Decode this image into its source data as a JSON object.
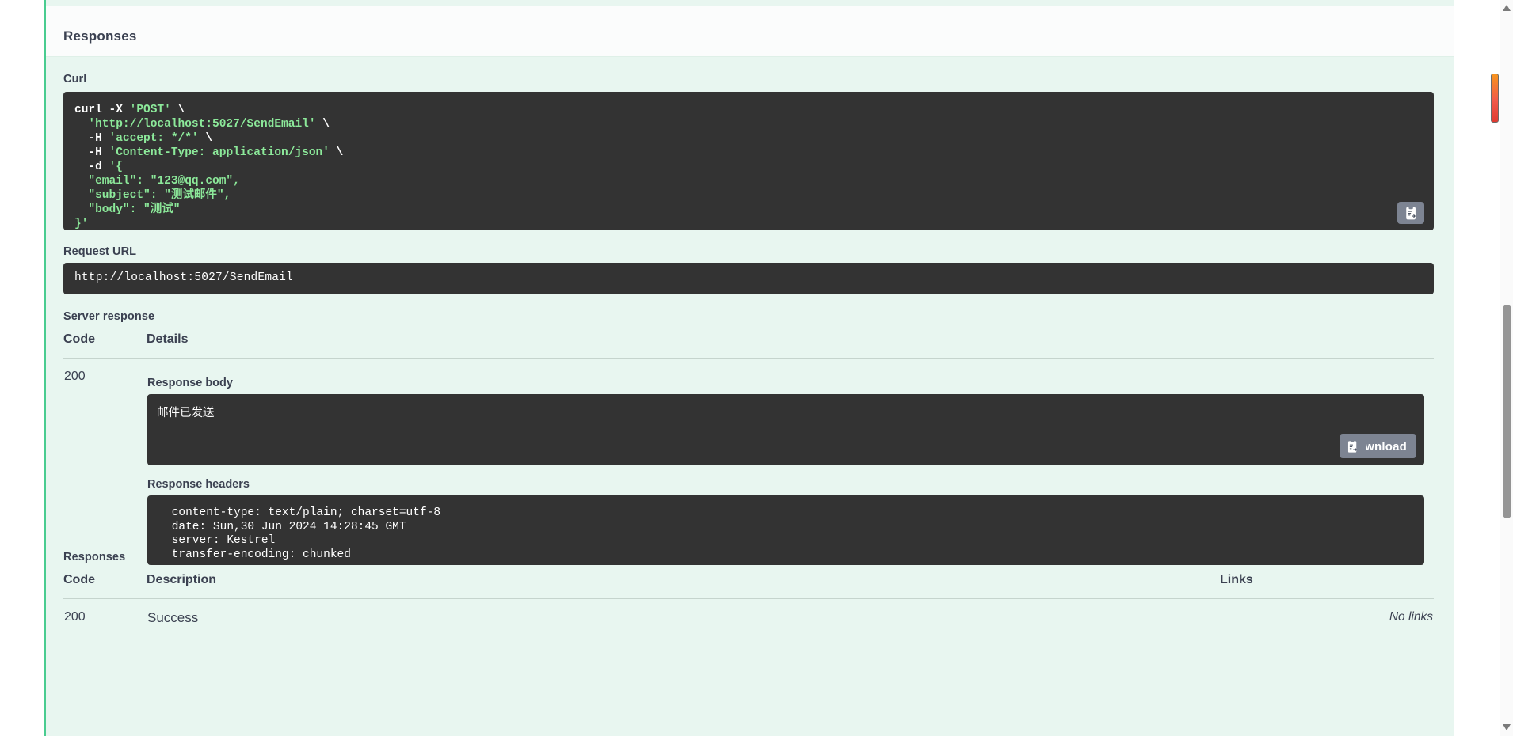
{
  "panel": {
    "title": "Responses"
  },
  "curl": {
    "label": "Curl",
    "lines": [
      "curl -X 'POST' \\",
      "  'http://localhost:5027/SendEmail' \\",
      "  -H 'accept: */*' \\",
      "  -H 'Content-Type: application/json' \\",
      "  -d '{",
      "  \"email\": \"123@qq.com\",",
      "  \"subject\": \"测试邮件\",",
      "  \"body\": \"测试\"",
      "}'"
    ],
    "copy_icon": "copy-to-clipboard-icon"
  },
  "request_url": {
    "label": "Request URL",
    "value": "http://localhost:5027/SendEmail"
  },
  "server_response": {
    "label": "Server response",
    "columns": {
      "code": "Code",
      "details": "Details"
    },
    "rows": [
      {
        "code": "200",
        "response_body_label": "Response body",
        "response_body": "邮件已发送",
        "copy_icon": "copy-to-clipboard-icon",
        "download_label": "Download",
        "response_headers_label": "Response headers",
        "response_headers": " content-type: text/plain; charset=utf-8 \n date: Sun,30 Jun 2024 14:28:45 GMT \n server: Kestrel \n transfer-encoding: chunked "
      }
    ]
  },
  "responses": {
    "label": "Responses",
    "columns": {
      "code": "Code",
      "description": "Description",
      "links": "Links"
    },
    "rows": [
      {
        "code": "200",
        "description": "Success",
        "links": "No links"
      }
    ]
  },
  "scrollbar": {
    "up_icon": "scroll-up-arrow-icon",
    "down_icon": "scroll-down-arrow-icon"
  },
  "colors": {
    "accent_green": "#49cc90",
    "panel_bg": "#e8f6f0",
    "code_bg": "#333333",
    "button_gray": "#7d8492",
    "text": "#3b4151"
  }
}
